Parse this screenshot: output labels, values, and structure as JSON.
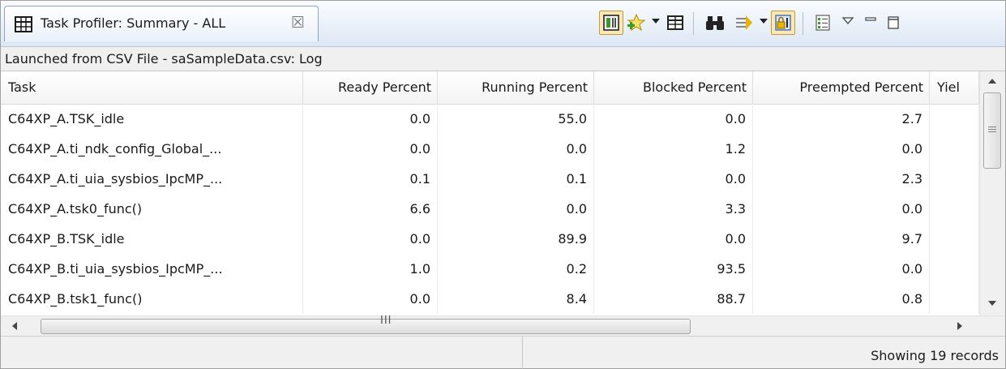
{
  "tab": {
    "title": "Task Profiler: Summary - ALL",
    "close_glyph": "☒",
    "icon": "table-icon"
  },
  "toolbar": {
    "buttons": [
      {
        "name": "group-columns-icon",
        "pressed": true
      },
      {
        "name": "star-plus-icon",
        "pressed": false,
        "dropdown": true
      },
      {
        "name": "table-view-icon",
        "pressed": false
      },
      {
        "name": "binoculars-icon",
        "pressed": false
      },
      {
        "name": "filter-arrows-icon",
        "pressed": false,
        "dropdown": true
      },
      {
        "name": "lock-scroll-icon",
        "pressed": true
      },
      {
        "name": "list-view-icon",
        "pressed": false
      },
      {
        "name": "view-menu-icon",
        "pressed": false
      },
      {
        "name": "minimize-icon",
        "pressed": false
      },
      {
        "name": "maximize-icon",
        "pressed": false
      }
    ]
  },
  "launch_info": "Launched from CSV File - saSampleData.csv: Log",
  "table": {
    "columns": [
      "Task",
      "Ready Percent",
      "Running Percent",
      "Blocked Percent",
      "Preempted Percent",
      "Yiel"
    ],
    "rows": [
      [
        "C64XP_A.TSK_idle",
        "0.0",
        "55.0",
        "0.0",
        "2.7",
        ""
      ],
      [
        "C64XP_A.ti_ndk_config_Global_...",
        "0.0",
        "0.0",
        "1.2",
        "0.0",
        ""
      ],
      [
        "C64XP_A.ti_uia_sysbios_IpcMP_...",
        "0.1",
        "0.1",
        "0.0",
        "2.3",
        ""
      ],
      [
        "C64XP_A.tsk0_func()",
        "6.6",
        "0.0",
        "3.3",
        "0.0",
        ""
      ],
      [
        "C64XP_B.TSK_idle",
        "0.0",
        "89.9",
        "0.0",
        "9.7",
        ""
      ],
      [
        "C64XP_B.ti_uia_sysbios_IpcMP_...",
        "1.0",
        "0.2",
        "93.5",
        "0.0",
        ""
      ],
      [
        "C64XP_B.tsk1_func()",
        "0.0",
        "8.4",
        "88.7",
        "0.8",
        ""
      ]
    ]
  },
  "hscroll_grip": "III",
  "footer": {
    "records_text": "Showing 19 records"
  },
  "colors": {
    "tab_border": "#8aa4c7",
    "pressed_bg": "#fbe8b4",
    "pressed_border": "#c29b3c",
    "icon_green": "#3c9a2c",
    "icon_yellow": "#e8b400"
  }
}
